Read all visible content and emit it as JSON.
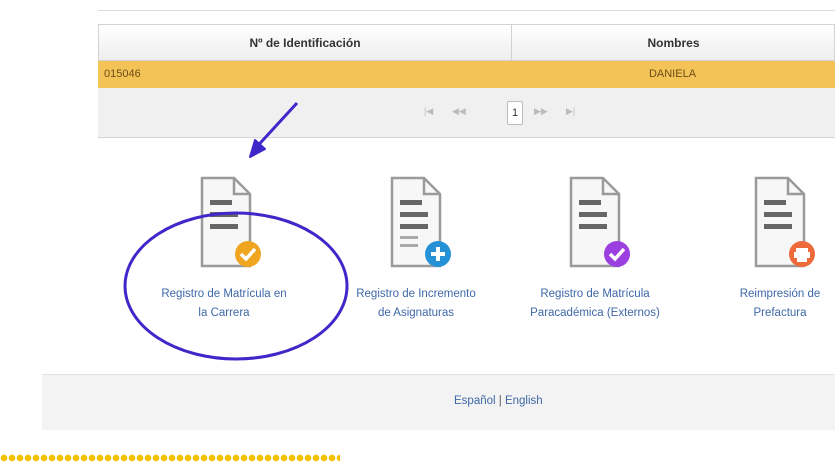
{
  "grid": {
    "columns": [
      "Nº de Identificación",
      "Nombres"
    ],
    "row": {
      "id": "015046",
      "name": "DANIELA"
    }
  },
  "pager": {
    "first": "|◀",
    "prev": "◀◀",
    "current_page": "1",
    "next": "▶▶",
    "last": "▶|"
  },
  "options": [
    {
      "label_line1": "Registro de Matrícula en",
      "label_line2": "la Carrera",
      "badge_icon": "check-icon",
      "badge_color": "#f0a520"
    },
    {
      "label_line1": "Registro de Incremento",
      "label_line2": "de Asignaturas",
      "badge_icon": "plus-icon",
      "badge_color": "#2592d8"
    },
    {
      "label_line1": "Registro de Matrícula",
      "label_line2": "Paracadémica (Externos)",
      "badge_icon": "check-icon",
      "badge_color": "#9b3fe0"
    },
    {
      "label_line1": "Reimpresión de",
      "label_line2": "Prefactura",
      "badge_icon": "printer-icon",
      "badge_color": "#ef6a3a"
    }
  ],
  "footer": {
    "lang_es": "Español",
    "separator": "|",
    "lang_en": "English"
  },
  "colors": {
    "selected_row": "#f4c357",
    "link": "#3e68a8",
    "annotation": "#3f27c9"
  }
}
